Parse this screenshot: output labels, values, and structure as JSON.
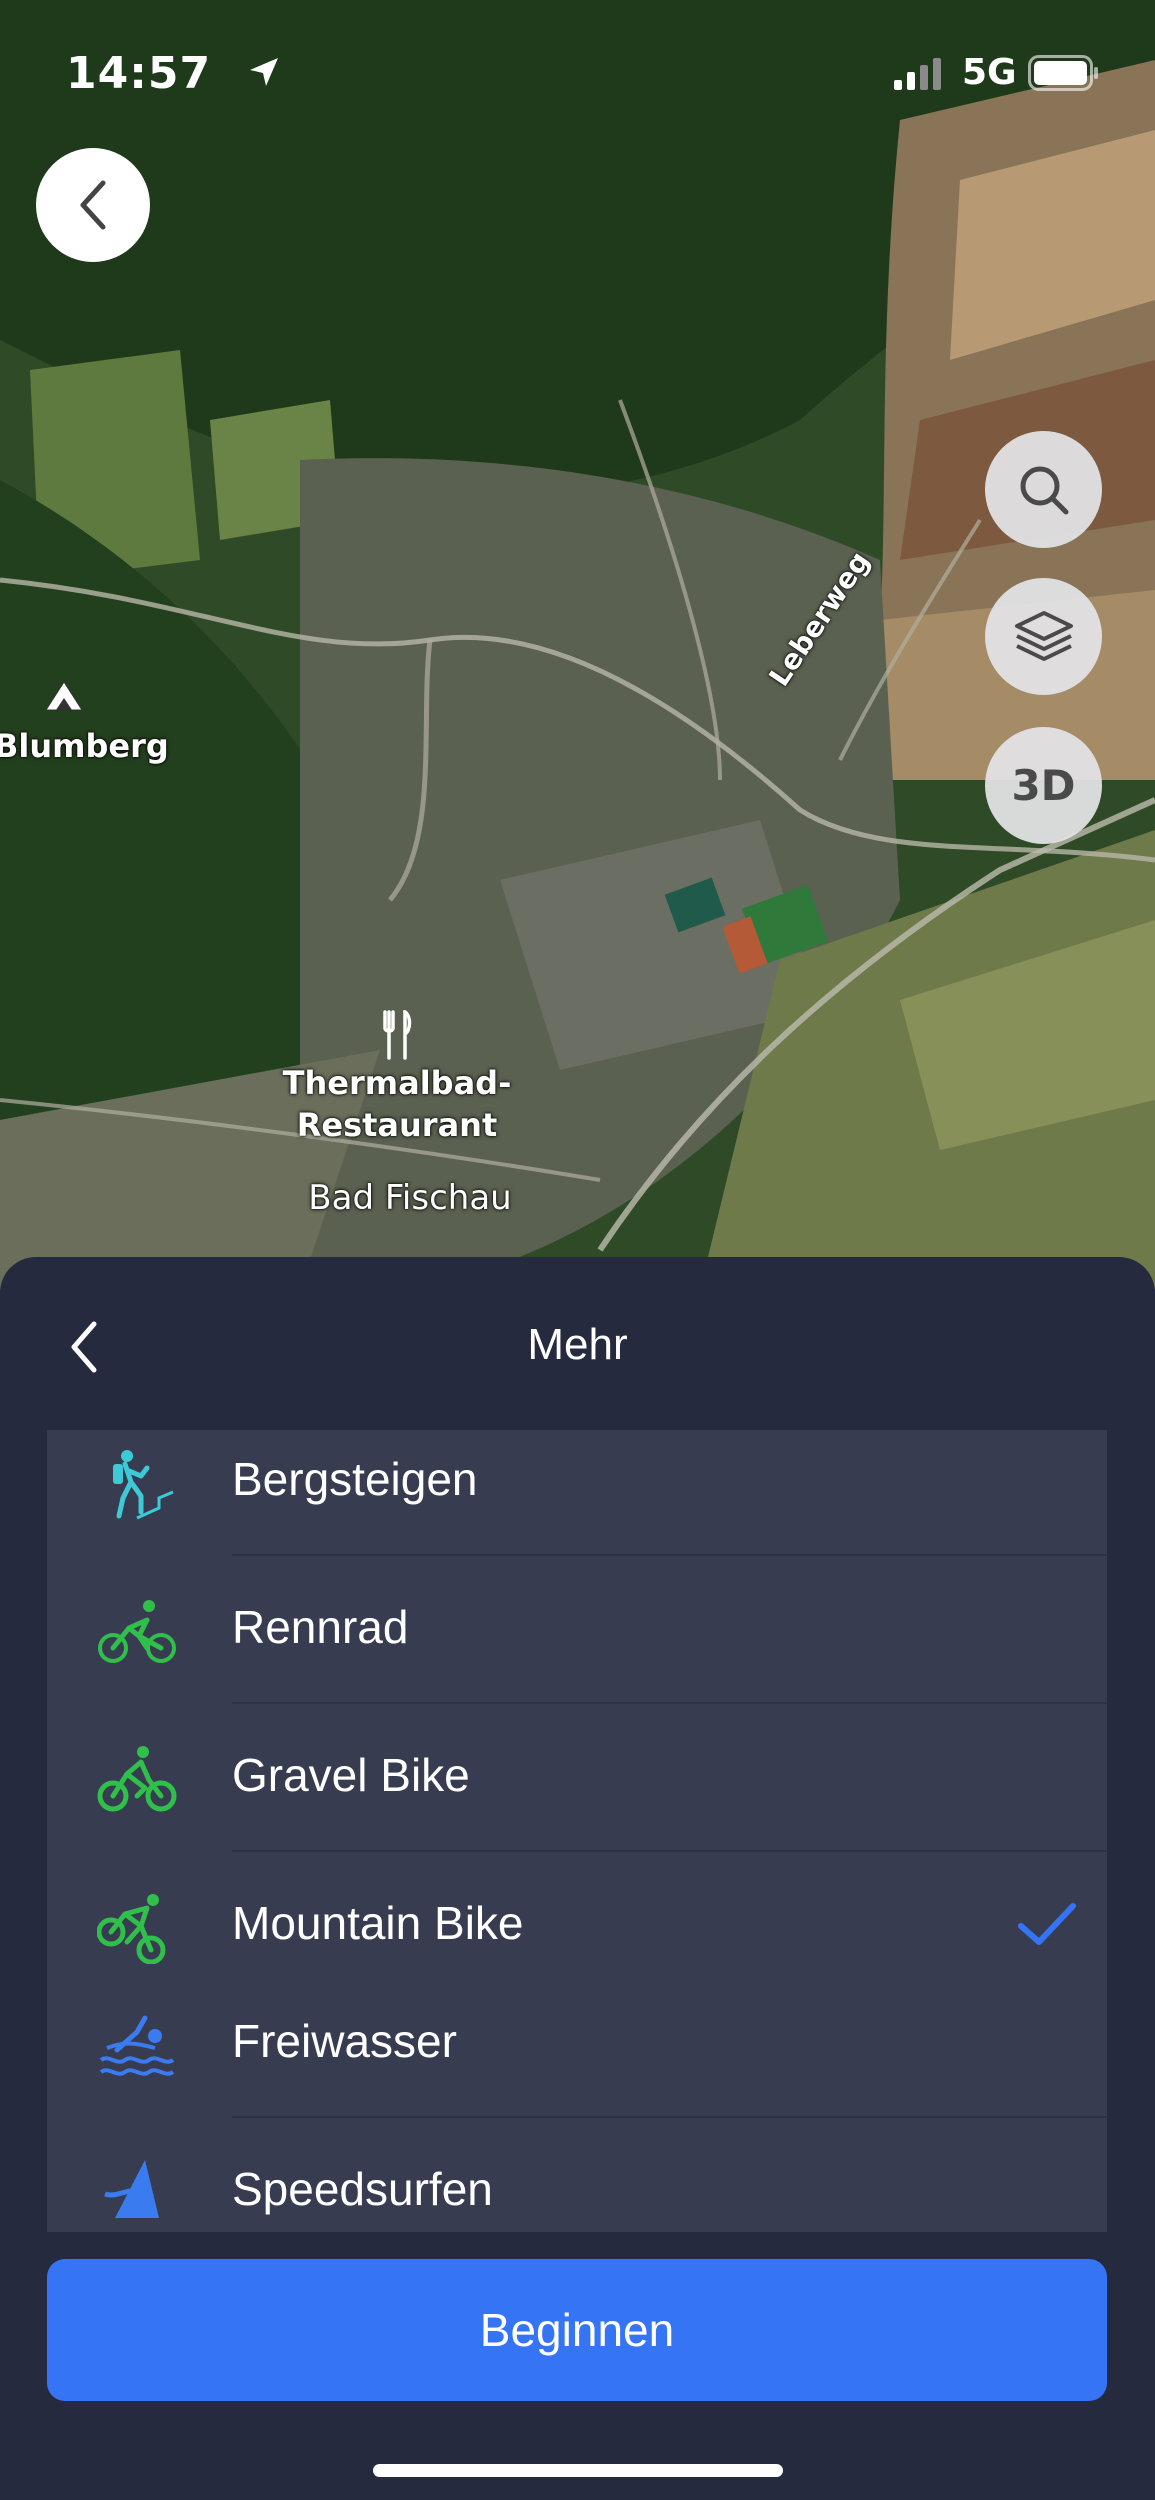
{
  "status_bar": {
    "time": "14:57",
    "network": "5G"
  },
  "map": {
    "labels": {
      "blumberg": "Blumberg",
      "leberweg": "Leberweg",
      "thermal_line1": "Thermalbad-",
      "thermal_line2": "Restaurant",
      "bad_fischau": "Bad Fischau"
    },
    "buttons": {
      "three_d": "3D"
    }
  },
  "sheet": {
    "title": "Mehr",
    "items": [
      {
        "label": "Bergsteigen",
        "icon": "mountaineering-icon",
        "color": "#3ec9d6",
        "selected": false
      },
      {
        "label": "Rennrad",
        "icon": "road-bike-icon",
        "color": "#2fbf4a",
        "selected": false
      },
      {
        "label": "Gravel Bike",
        "icon": "gravel-bike-icon",
        "color": "#2fbf4a",
        "selected": false
      },
      {
        "label": "Mountain Bike",
        "icon": "mountain-bike-icon",
        "color": "#2fbf4a",
        "selected": true
      },
      {
        "label": "Freiwasser",
        "icon": "open-water-swim-icon",
        "color": "#3a7bf0",
        "selected": false
      },
      {
        "label": "Speedsurfen",
        "icon": "speedsurfing-icon",
        "color": "#3a7bf0",
        "selected": false
      }
    ],
    "begin_label": "Beginnen"
  },
  "colors": {
    "accent": "#3575f5",
    "sheet_bg": "#262a3e",
    "list_bg": "#383c51"
  }
}
